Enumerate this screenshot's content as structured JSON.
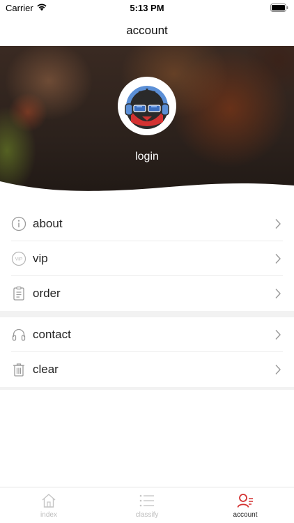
{
  "status_bar": {
    "carrier": "Carrier",
    "time": "5:13 PM"
  },
  "nav": {
    "title": "account"
  },
  "profile": {
    "login_label": "login"
  },
  "menu_groups": [
    {
      "items": [
        {
          "label": "about",
          "icon": "info-icon"
        },
        {
          "label": "vip",
          "icon": "vip-icon"
        },
        {
          "label": "order",
          "icon": "clipboard-icon"
        }
      ]
    },
    {
      "items": [
        {
          "label": "contact",
          "icon": "headphones-icon"
        },
        {
          "label": "clear",
          "icon": "trash-icon"
        }
      ]
    }
  ],
  "vip_badge": "VIP",
  "tabs": [
    {
      "label": "index",
      "icon": "home-icon",
      "active": false
    },
    {
      "label": "classify",
      "icon": "list-icon",
      "active": false
    },
    {
      "label": "account",
      "icon": "account-icon",
      "active": true
    }
  ],
  "colors": {
    "accent": "#d33232",
    "inactive": "#bdbdbd"
  }
}
